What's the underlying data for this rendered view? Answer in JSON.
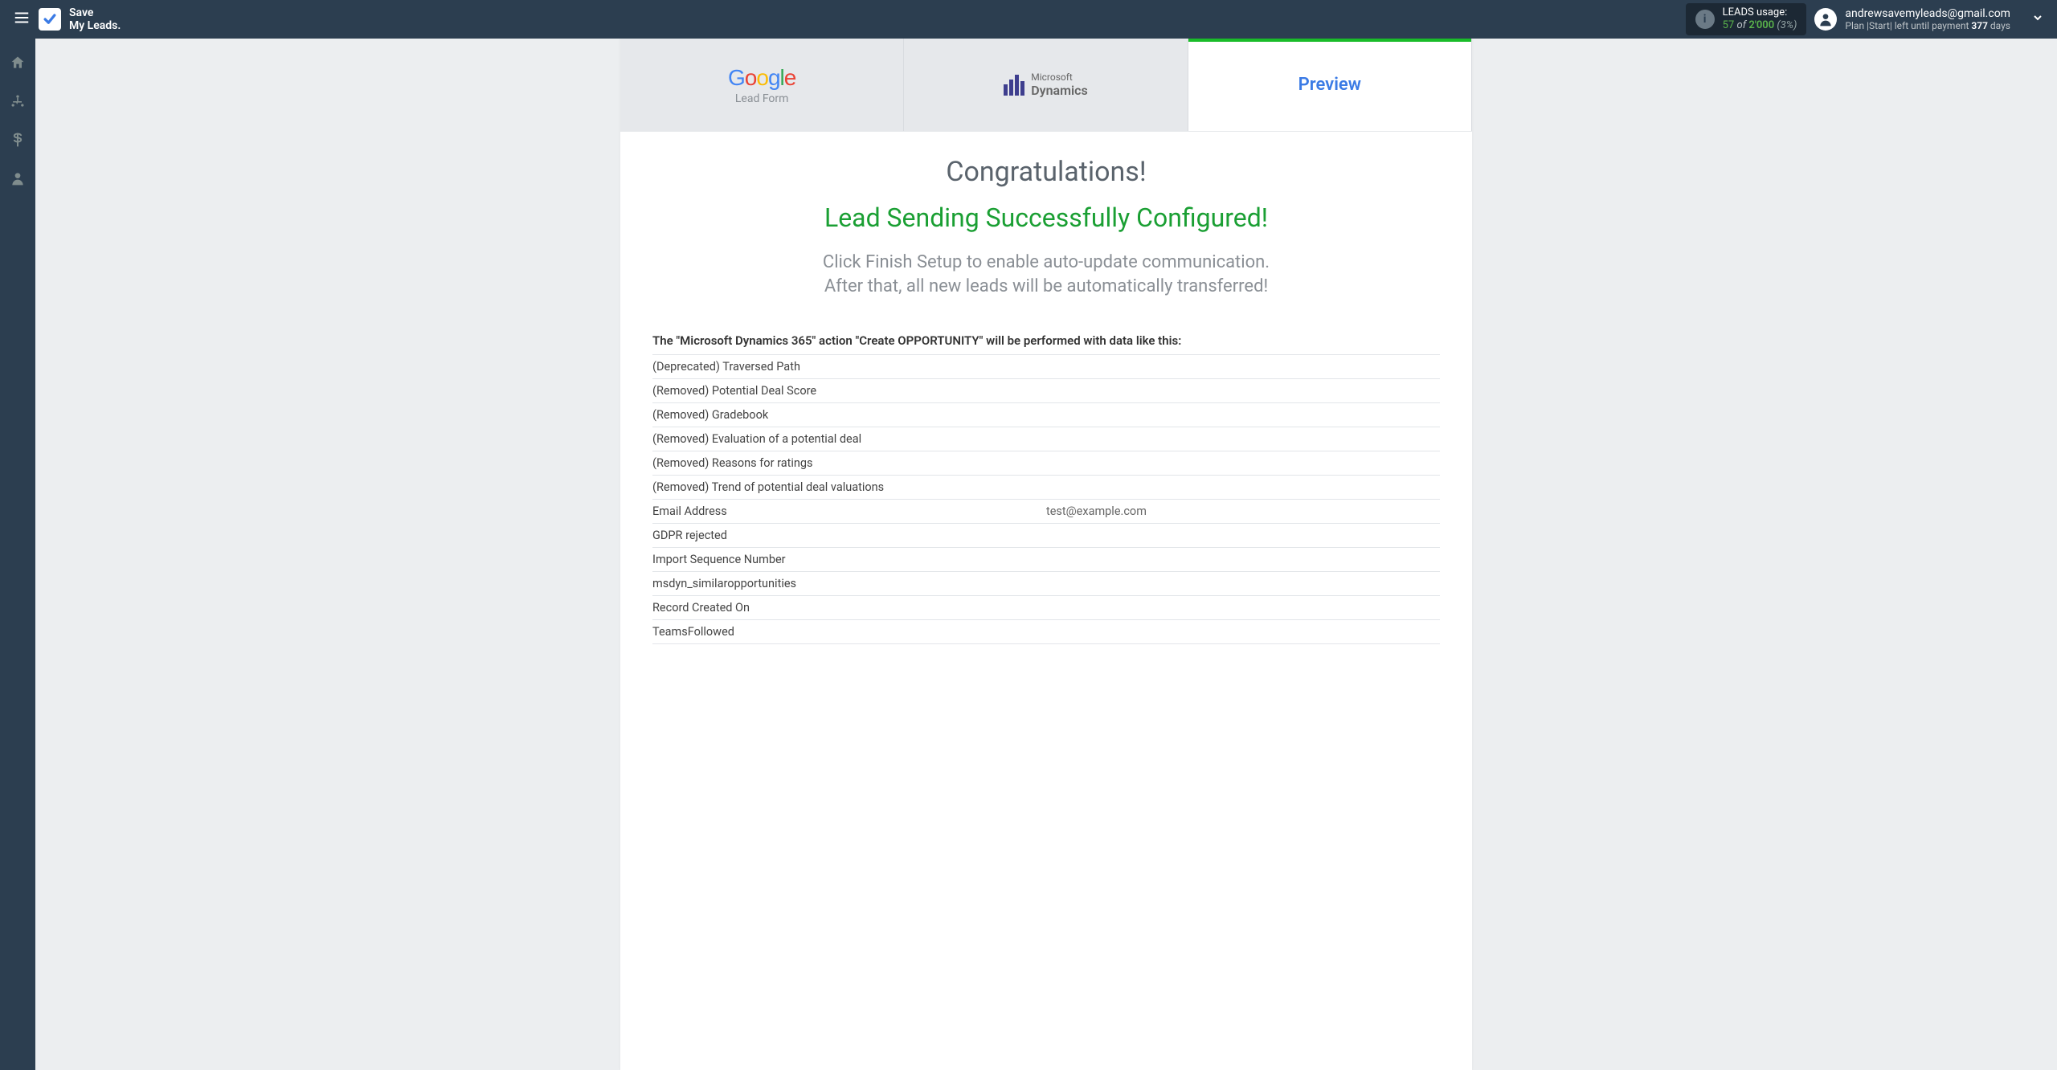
{
  "brand": {
    "line1": "Save",
    "line2": "My Leads."
  },
  "usage": {
    "label": "LEADS usage:",
    "used": "57",
    "of": "of",
    "limit": "2'000",
    "pct": "(3%)"
  },
  "user": {
    "email": "andrewsavemyleads@gmail.com",
    "plan_prefix": "Plan |Start| left until payment ",
    "days_num": "377",
    "plan_suffix": " days"
  },
  "sidebar": {
    "items": [
      {
        "name": "home"
      },
      {
        "name": "integrations"
      },
      {
        "name": "billing"
      },
      {
        "name": "account"
      }
    ]
  },
  "tabs": {
    "google": {
      "label": "Google",
      "sub": "Lead Form"
    },
    "ms": {
      "label1": "Microsoft",
      "label2": "Dynamics"
    },
    "preview": {
      "label": "Preview"
    }
  },
  "messages": {
    "congrats": "Congratulations!",
    "success": "Lead Sending Successfully Configured!",
    "instr1": "Click Finish Setup to enable auto-update communication.",
    "instr2": "After that, all new leads will be automatically transferred!"
  },
  "preview": {
    "heading": "The \"Microsoft Dynamics 365\" action \"Create OPPORTUNITY\" will be performed with data like this:",
    "rows": [
      {
        "field": "(Deprecated) Traversed Path",
        "value": ""
      },
      {
        "field": "(Removed) Potential Deal Score",
        "value": ""
      },
      {
        "field": "(Removed) Gradebook",
        "value": ""
      },
      {
        "field": "(Removed) Evaluation of a potential deal",
        "value": ""
      },
      {
        "field": "(Removed) Reasons for ratings",
        "value": ""
      },
      {
        "field": "(Removed) Trend of potential deal valuations",
        "value": ""
      },
      {
        "field": "Email Address",
        "value": "test@example.com"
      },
      {
        "field": "GDPR rejected",
        "value": ""
      },
      {
        "field": "Import Sequence Number",
        "value": ""
      },
      {
        "field": "msdyn_similaropportunities",
        "value": ""
      },
      {
        "field": "Record Created On",
        "value": ""
      },
      {
        "field": "TeamsFollowed",
        "value": ""
      }
    ]
  }
}
